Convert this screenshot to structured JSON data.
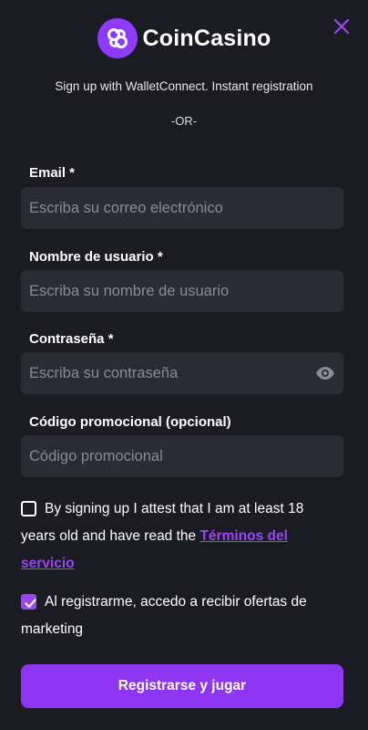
{
  "header": {
    "brand_name": "CoinCasino",
    "close_icon": "close-icon"
  },
  "walletconnect": {
    "text": "Sign up with WalletConnect. Instant registration"
  },
  "divider": {
    "text": "-OR-"
  },
  "form": {
    "email": {
      "label": "Email *",
      "placeholder": "Escriba su correo electrónico",
      "value": ""
    },
    "username": {
      "label": "Nombre de usuario *",
      "placeholder": "Escriba su nombre de usuario",
      "value": ""
    },
    "password": {
      "label": "Contraseña *",
      "placeholder": "Escriba su contraseña",
      "value": "",
      "toggle_icon": "eye-icon"
    },
    "promo": {
      "label": "Código promocional (opcional)",
      "placeholder": "Código promocional",
      "value": ""
    }
  },
  "consents": {
    "age": {
      "checked": false,
      "text": "By signing up I attest that I am at least 18 years old and have read the ",
      "link_text": "Términos del servicio"
    },
    "marketing": {
      "checked": true,
      "text": "Al registrarme, accedo a recibir ofertas de marketing"
    }
  },
  "submit": {
    "label": "Registrarse y jugar"
  },
  "colors": {
    "background": "#1b1b23",
    "field": "#2b2b35",
    "accent": "#8e35f2",
    "link": "#9b45f5"
  }
}
